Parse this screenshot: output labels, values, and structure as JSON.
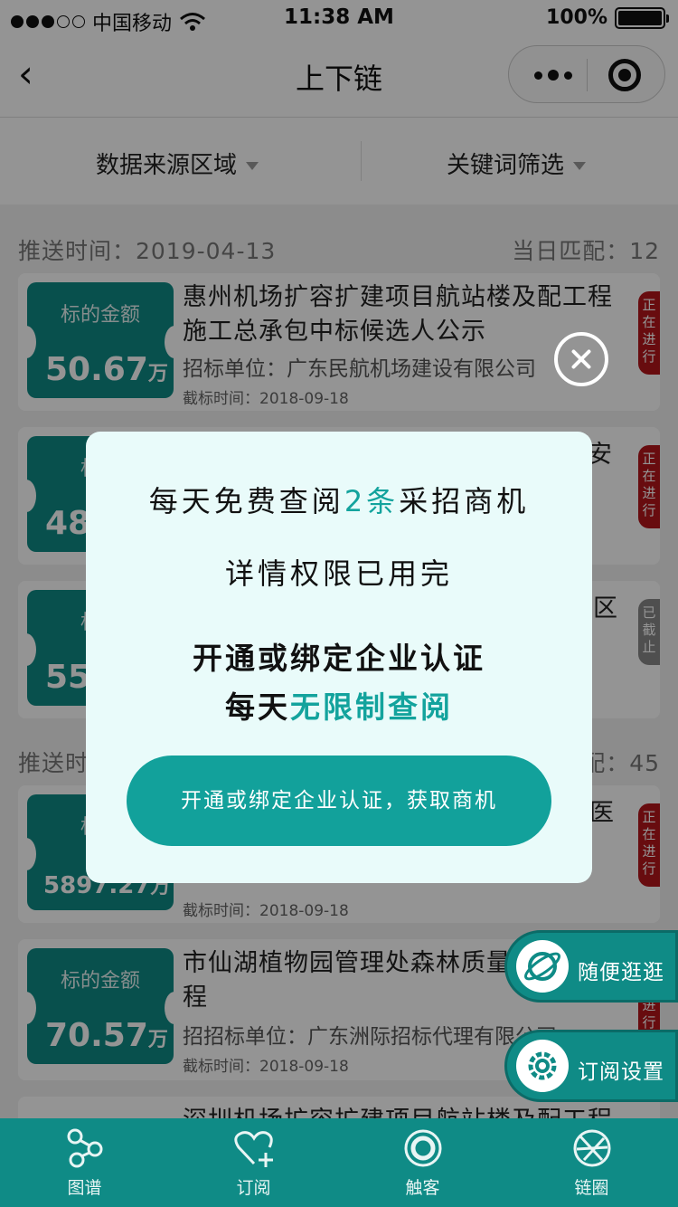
{
  "status_bar": {
    "carrier": "中国移动",
    "time": "11:38 AM",
    "battery": "100%"
  },
  "nav": {
    "title": "上下链"
  },
  "filters": {
    "region_label": "数据来源区域",
    "keyword_label": "关键词筛选"
  },
  "groups": [
    {
      "push_time": "推送时间：2019-04-13",
      "match": "当日匹配：12"
    },
    {
      "push_time": "推送时",
      "match": "配：45"
    }
  ],
  "cards": [
    {
      "amount_label": "标的金额",
      "amount": "50.67",
      "unit": "万",
      "title": "惠州机场扩容扩建项目航站楼及配工程施工总承包中标候选人公示",
      "org": "招标单位：广东民航机场建设有限公司",
      "deadline": "截标时间：2018-09-18",
      "status": "正在进行"
    },
    {
      "amount_label": "标的",
      "amount": "48.",
      "unit": "",
      "title": "安",
      "org": "",
      "deadline": "",
      "status": "正在进行"
    },
    {
      "amount_label": "标的",
      "amount": "550",
      "unit": "",
      "title": "区",
      "org": "",
      "deadline": "",
      "status": "已截止"
    },
    {
      "amount_label": "标的",
      "amount": "5897.27",
      "unit": "万",
      "title": "医",
      "org": "",
      "deadline": "截标时间：2018-09-18",
      "status": "正在进行"
    },
    {
      "amount_label": "标的金额",
      "amount": "70.57",
      "unit": "万",
      "title": "市仙湖植物园管理处森林质量工程",
      "org": "招招标单位：广东洲际招标代理有限公司",
      "deadline": "截标时间：2018-09-18",
      "status": "正在进行"
    },
    {
      "title": "深圳机场扩容扩建项目航站楼及配工程"
    }
  ],
  "floating": {
    "browse": "随便逛逛",
    "subscribe_settings": "订阅设置"
  },
  "tabs": [
    {
      "label": "图谱",
      "icon": "graph-icon"
    },
    {
      "label": "订阅",
      "icon": "heart-plus-icon"
    },
    {
      "label": "触客",
      "icon": "target-icon"
    },
    {
      "label": "链圈",
      "icon": "aperture-icon"
    }
  ],
  "modal": {
    "line1_pre": "每天免费查阅",
    "line1_accent": "2条",
    "line1_post": "采招商机",
    "line2": "详情权限已用完",
    "line3": "开通或绑定企业认证",
    "line4_pre": "每天",
    "line4_accent": "无限制查阅",
    "cta": "开通或绑定企业认证，获取商机"
  },
  "colors": {
    "primary": "#0f8b86",
    "accent": "#13a39d",
    "ribbon_active": "#b3161b",
    "ribbon_closed": "#888888"
  }
}
